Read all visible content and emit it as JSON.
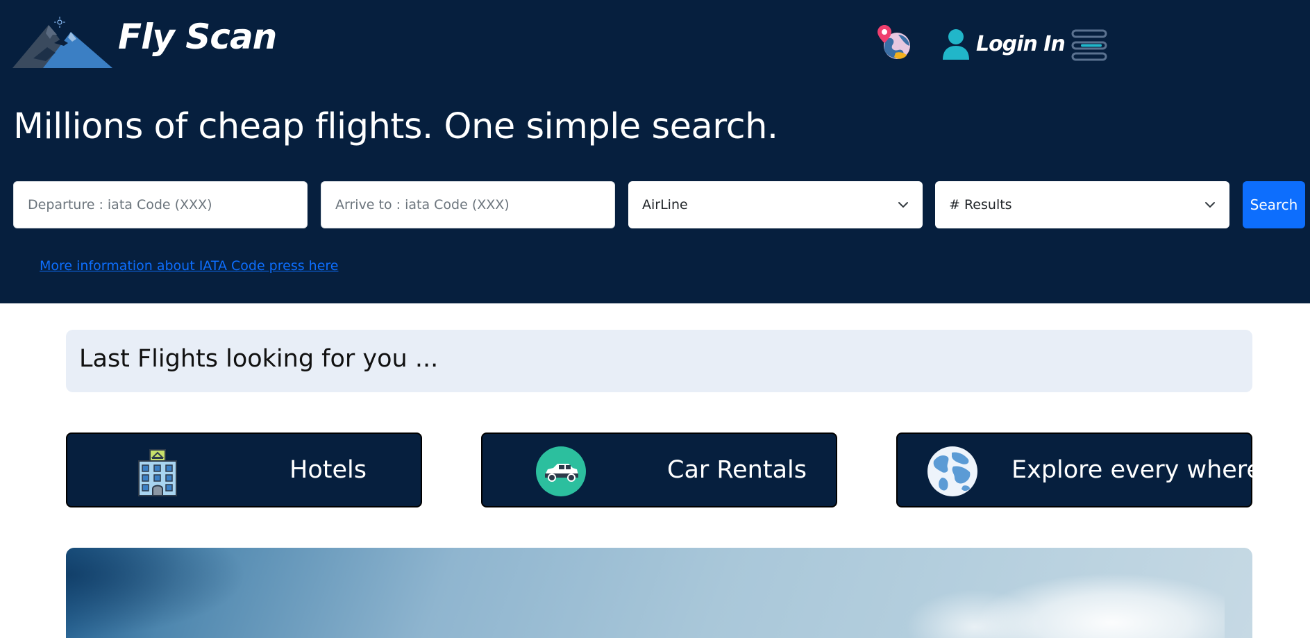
{
  "brand": {
    "name": "Fly Scan",
    "logo_icon": "mountain-logo-icon"
  },
  "nav": {
    "map_icon": "map-globe-icon",
    "login_label": "Login In",
    "login_icon": "user-icon",
    "menu_icon": "hamburger-menu-icon"
  },
  "hero": {
    "headline": "Millions of cheap flights. One simple search."
  },
  "search": {
    "departure_placeholder": "Departure : iata Code (XXX)",
    "arrival_placeholder": "Arrive to : iata Code (XXX)",
    "airline_selected": "AirLine",
    "results_selected": "# Results",
    "search_label": "Search"
  },
  "iata_link": "More information about IATA Code press here",
  "last_flights": {
    "title": "Last Flights looking for you ..."
  },
  "cards": [
    {
      "label": "Hotels",
      "icon": "hotel-building-icon"
    },
    {
      "label": "Car Rentals",
      "icon": "car-icon"
    },
    {
      "label": "Explore every where",
      "icon": "globe-icon"
    }
  ],
  "colors": {
    "hero_bg": "#061f3e",
    "accent_blue": "#0d6efd",
    "panel_bg": "#e8eef7"
  }
}
